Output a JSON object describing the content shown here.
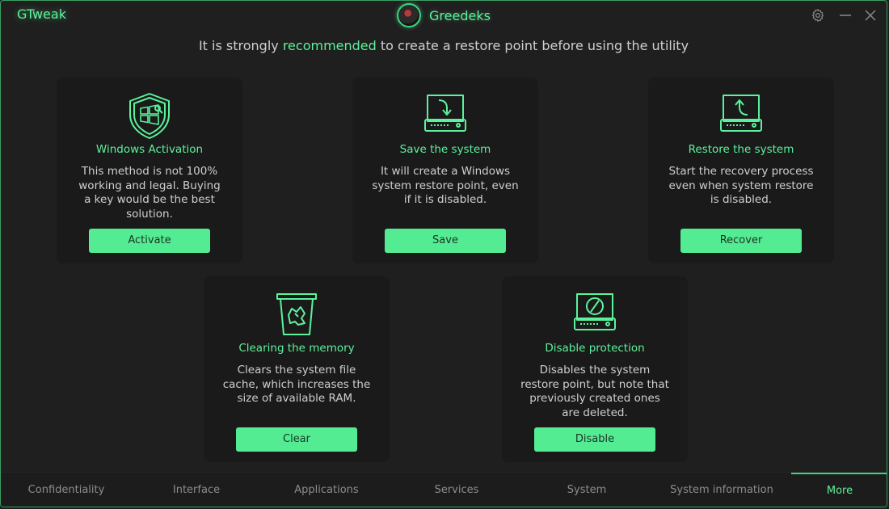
{
  "titlebar": {
    "app_title": "GTweak",
    "username": "Greedeks"
  },
  "notice": {
    "before": "It is strongly ",
    "highlight": "recommended",
    "after": " to create a restore point before using the utility"
  },
  "cards": [
    {
      "icon": "shield-windows-icon",
      "title": "Windows Activation",
      "description": "This method is not 100% working and legal. Buying a key would be the best solution.",
      "button": "Activate"
    },
    {
      "icon": "drive-save-icon",
      "title": "Save the system",
      "description": "It will create a Windows system restore point, even if it is disabled.",
      "button": "Save"
    },
    {
      "icon": "drive-restore-icon",
      "title": "Restore the system",
      "description": "Start the recovery process even when system restore is disabled.",
      "button": "Recover"
    },
    {
      "icon": "trash-bin-icon",
      "title": "Clearing the memory",
      "description": "Clears the system file cache, which increases the size of available RAM.",
      "button": "Clear"
    },
    {
      "icon": "drive-disable-icon",
      "title": "Disable protection",
      "description": "Disables the system restore point, but note that previously created ones are deleted.",
      "button": "Disable"
    }
  ],
  "tabs": [
    {
      "label": "Confidentiality"
    },
    {
      "label": "Interface"
    },
    {
      "label": "Applications"
    },
    {
      "label": "Services"
    },
    {
      "label": "System"
    },
    {
      "label": "System information"
    },
    {
      "label": "More",
      "active": true
    }
  ],
  "colors": {
    "accent": "#5cf29b",
    "button": "#53ec93",
    "card_bg": "#1a1a1a",
    "window_bg": "#1f1f1f"
  }
}
